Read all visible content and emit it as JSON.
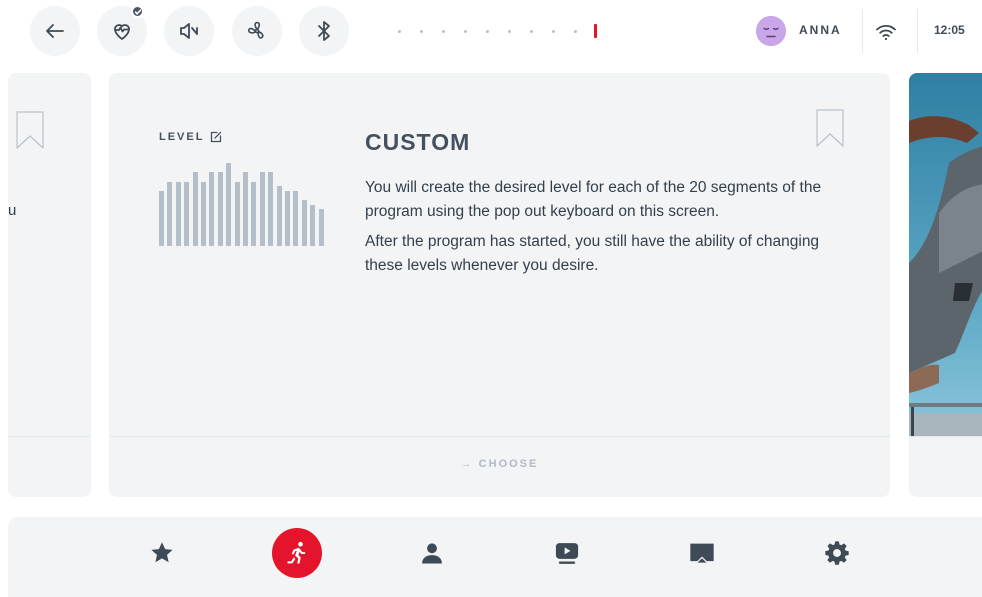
{
  "topbar": {
    "user_name": "ANNA",
    "clock": "12:05",
    "page_indicator": {
      "total": 10,
      "active": 10
    }
  },
  "left_card": {
    "snippet": "u"
  },
  "program": {
    "level_label": "LEVEL",
    "title": "CUSTOM",
    "description": [
      "You will create the desired level for each of the 20 segments of the program using the pop out keyboard on this screen.",
      "After the program has started, you still have the ability of changing these levels whenever you desire."
    ],
    "choose_label": "→ CHOOSE",
    "level_profile": [
      12,
      14,
      14,
      14,
      16,
      14,
      16,
      16,
      18,
      14,
      16,
      14,
      16,
      16,
      13,
      12,
      12,
      10,
      9,
      8
    ]
  },
  "bottom_nav": {
    "items": [
      "favorites-icon",
      "running-icon",
      "user-icon",
      "video-icon",
      "screen-mirror-icon",
      "settings-icon"
    ],
    "active_index": 1
  },
  "colors": {
    "accent": "#e3142b",
    "surface": "#f2f4f6",
    "text": "#333f4b",
    "bar": "#b4bfca"
  }
}
